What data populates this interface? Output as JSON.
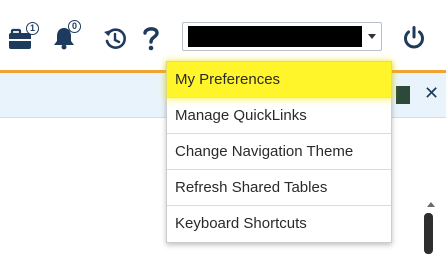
{
  "toolbar": {
    "briefcase_badge": "1",
    "bell_badge": "0"
  },
  "staff_select": {
    "value_redacted": true
  },
  "user_menu": {
    "items": [
      {
        "label": "My Preferences",
        "highlighted": true
      },
      {
        "label": "Manage QuickLinks",
        "highlighted": false
      },
      {
        "label": "Change Navigation Theme",
        "highlighted": false
      },
      {
        "label": "Refresh Shared Tables",
        "highlighted": false
      },
      {
        "label": "Keyboard Shortcuts",
        "highlighted": false
      }
    ]
  },
  "colors": {
    "accent_orange": "#f0a332",
    "header_band": "#e9f3fb",
    "highlight_yellow": "#fff52a",
    "icon_navy": "#1e3a5c"
  },
  "icons": {
    "briefcase": "briefcase-icon",
    "bell": "bell-icon",
    "history": "history-icon",
    "help": "help-icon",
    "power": "power-icon",
    "close": "close-icon"
  }
}
